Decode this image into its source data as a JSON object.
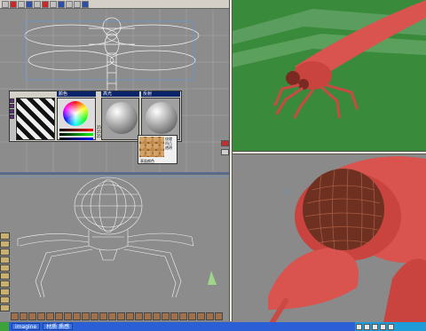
{
  "app": {
    "taskbar_item": "imagine",
    "taskbar_item_2": "材质 质感"
  },
  "material_editor": {
    "tabs": [
      "颜色",
      "高光",
      "反射"
    ],
    "values": [
      "255",
      "255",
      "255"
    ]
  },
  "texture_panel": {
    "labels": [
      "纹理",
      "凹凸",
      "透明"
    ],
    "caption": "表面颜色"
  },
  "colors": {
    "wireframe": "#ffffff",
    "perspective_bg": "#3a8a3c",
    "body": "#d9534f",
    "head": "#8a3020",
    "taskbar": "#2a5fd6"
  },
  "icons": {
    "toolbar": [
      "arrow-icon",
      "stop-icon",
      "grid-icon",
      "scale-icon",
      "rotate-icon",
      "render-icon",
      "paint-icon",
      "light-icon",
      "camera-icon",
      "layers-icon",
      "save-icon"
    ],
    "right_toolbar": [
      "render-icon",
      "sphere-icon",
      "cube-icon",
      "light-icon",
      "camera-icon",
      "texture-icon",
      "gear-icon",
      "help-icon"
    ]
  }
}
